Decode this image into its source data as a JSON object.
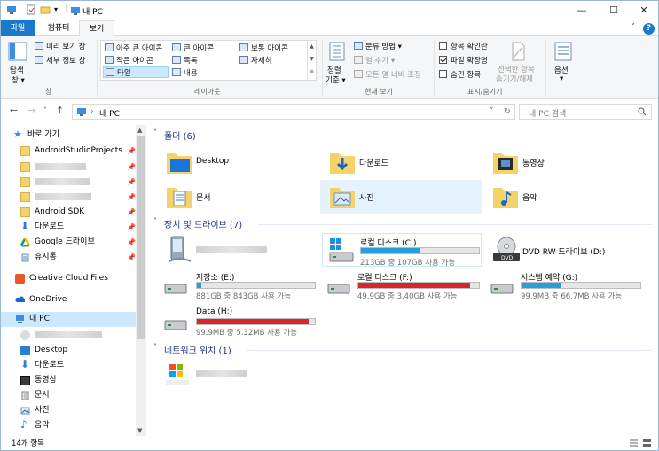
{
  "window": {
    "title": "내 PC",
    "min": "—",
    "max": "☐",
    "close": "✕"
  },
  "tabs": {
    "file": "파일",
    "computer": "컴퓨터",
    "view": "보기"
  },
  "ribbon": {
    "panes": {
      "nav_pane": "탐색",
      "nav_pane2": "창",
      "preview": "미리 보기 창",
      "details": "세부 정보 창",
      "label": "창"
    },
    "layout": {
      "items": [
        "아주 큰 아이콘",
        "큰 아이콘",
        "보통 아이콘",
        "작은 아이콘",
        "목록",
        "자세히",
        "타일",
        "내용"
      ],
      "label": "레이아웃"
    },
    "current_view": {
      "sort": "정렬",
      "sort2": "기준",
      "group": "분류 방법",
      "add_col": "열 추가",
      "fit": "모든 열 너비 조정",
      "label": "현재 보기"
    },
    "showhide": {
      "checkboxes": "항목 확인란",
      "extensions": "파일 확장명",
      "hidden": "숨긴 항목",
      "hide_selected": "선택한 항목",
      "hide_selected2": "숨기기/해제",
      "label": "표시/숨기기"
    },
    "options": "옵션",
    "checks": {
      "checkboxes": false,
      "extensions": true,
      "hidden": false
    }
  },
  "address": {
    "path": "내 PC",
    "search_placeholder": "내 PC 검색"
  },
  "nav": {
    "quick_access": "바로 가기",
    "items": [
      {
        "label": "AndroidStudioProjects",
        "pinned": true
      },
      {
        "label": "Android SDK",
        "pinned": true
      },
      {
        "label": "다운로드",
        "pinned": true
      },
      {
        "label": "Google 드라이브",
        "pinned": true
      },
      {
        "label": "휴지통",
        "pinned": true
      }
    ],
    "pin": "📌",
    "cloud": "Creative Cloud Files",
    "onedrive": "OneDrive",
    "thispc": "내 PC",
    "pc_items": [
      "Desktop",
      "다운로드",
      "동영상",
      "문서",
      "사진",
      "음악"
    ]
  },
  "sections": {
    "folders": "폴더 (6)",
    "drives": "장치 및 드라이브 (7)",
    "network": "네트워크 위치 (1)"
  },
  "folders": [
    "Desktop",
    "다운로드",
    "동영상",
    "문서",
    "사진",
    "음악"
  ],
  "drives": [
    {
      "name": "로컬 디스크 (C:)",
      "info": "213GB 중 107GB 사용 가능",
      "used_pct": 50,
      "color": "#26a0da"
    },
    {
      "name": "DVD RW 드라이브 (D:)",
      "info": "",
      "used_pct": null,
      "color": ""
    },
    {
      "name": "저장소 (E:)",
      "info": "881GB 중 843GB 사용 가능",
      "used_pct": 4,
      "color": "#26a0da"
    },
    {
      "name": "로컬 디스크 (F:)",
      "info": "49.9GB 중 3.40GB 사용 가능",
      "used_pct": 93,
      "color": "#da2626"
    },
    {
      "name": "시스템 예약 (G:)",
      "info": "99.9MB 중 66.7MB 사용 가능",
      "used_pct": 33,
      "color": "#26a0da"
    },
    {
      "name": "Data (H:)",
      "info": "99.9MB 중 5.32MB 사용 가능",
      "used_pct": 95,
      "color": "#da2626"
    }
  ],
  "status": {
    "count": "14개 항목"
  }
}
